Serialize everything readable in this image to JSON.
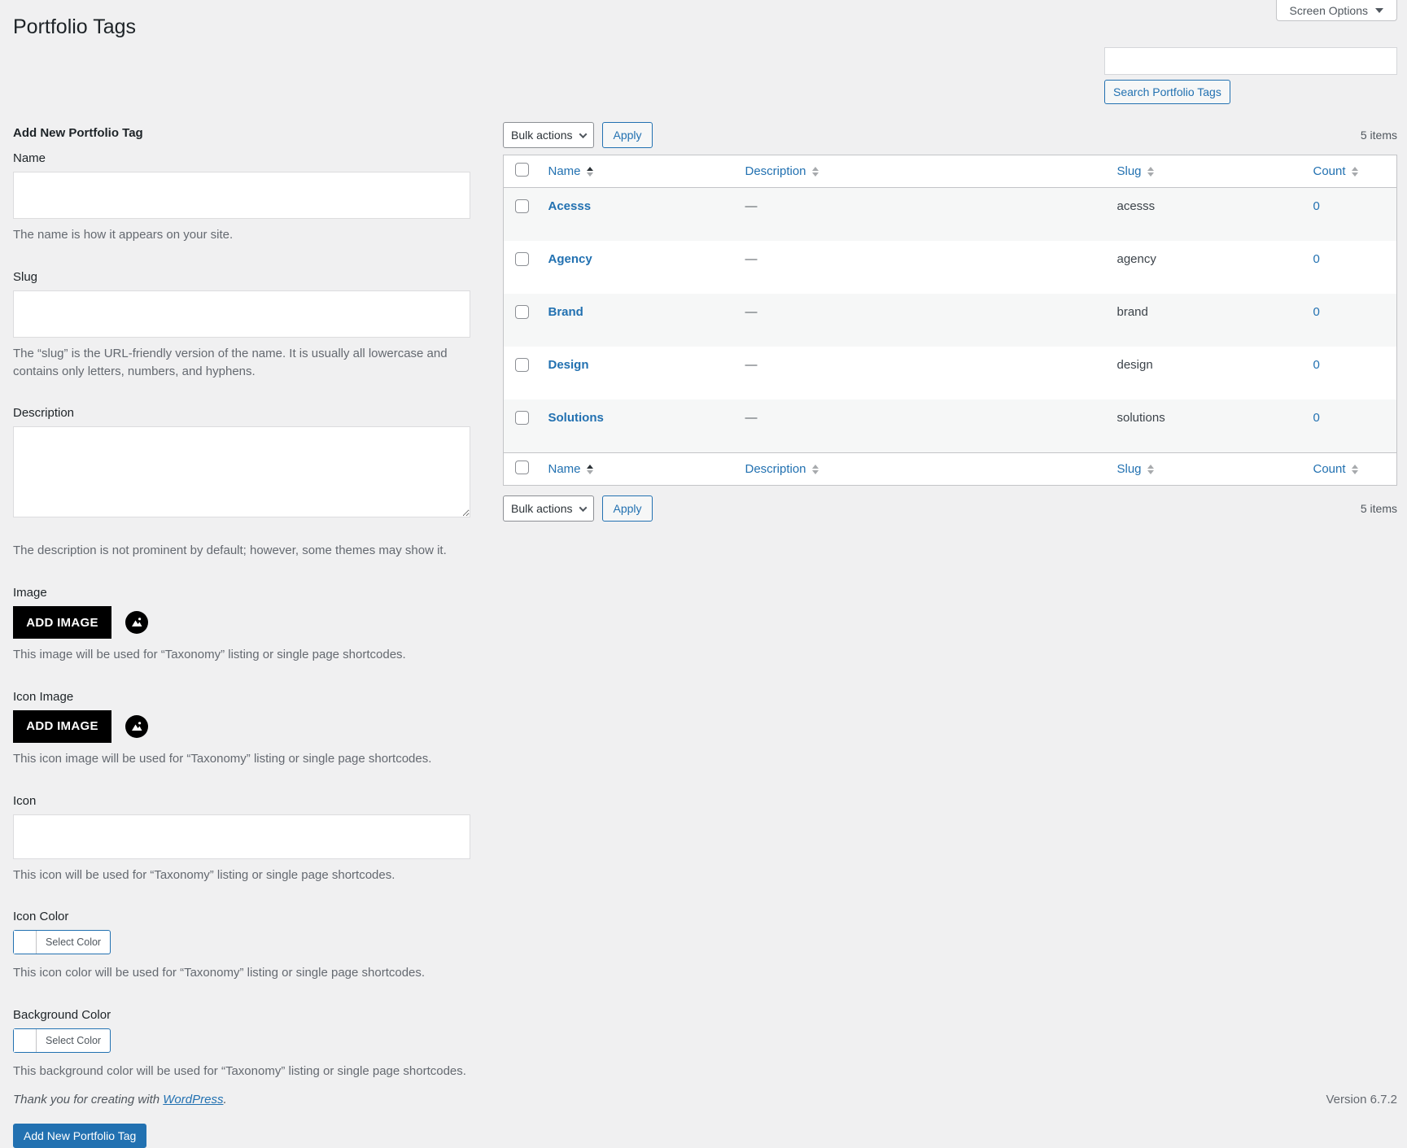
{
  "page": {
    "title": "Portfolio Tags",
    "screen_options_label": "Screen Options"
  },
  "search": {
    "input_value": "",
    "button_label": "Search Portfolio Tags"
  },
  "form": {
    "heading": "Add New Portfolio Tag",
    "name": {
      "label": "Name",
      "value": "",
      "help": "The name is how it appears on your site."
    },
    "slug": {
      "label": "Slug",
      "value": "",
      "help": "The “slug” is the URL-friendly version of the name. It is usually all lowercase and contains only letters, numbers, and hyphens."
    },
    "description": {
      "label": "Description",
      "value": "",
      "help": "The description is not prominent by default; however, some themes may show it."
    },
    "image": {
      "label": "Image",
      "button_label": "ADD IMAGE",
      "icon": "image-circle-icon",
      "help": "This image will be used for “Taxonomy” listing or single page shortcodes."
    },
    "icon_image": {
      "label": "Icon Image",
      "button_label": "ADD IMAGE",
      "icon": "image-circle-icon",
      "help": "This icon image will be used for “Taxonomy” listing or single page shortcodes."
    },
    "icon": {
      "label": "Icon",
      "value": "",
      "help": "This icon will be used for “Taxonomy” listing or single page shortcodes."
    },
    "icon_color": {
      "label": "Icon Color",
      "button_label": "Select Color",
      "help": "This icon color will be used for “Taxonomy” listing or single page shortcodes."
    },
    "background_color": {
      "label": "Background Color",
      "button_label": "Select Color",
      "help": "This background color will be used for “Taxonomy” listing or single page shortcodes."
    },
    "submit_label": "Add New Portfolio Tag"
  },
  "table": {
    "bulk_actions_label": "Bulk actions",
    "apply_label": "Apply",
    "items_count": "5 items",
    "columns": {
      "name": "Name",
      "description": "Description",
      "slug": "Slug",
      "count": "Count"
    },
    "sorted_by": "Name ascending",
    "rows": [
      {
        "name": "Acesss",
        "description": "—",
        "slug": "acesss",
        "count": "0"
      },
      {
        "name": "Agency",
        "description": "—",
        "slug": "agency",
        "count": "0"
      },
      {
        "name": "Brand",
        "description": "—",
        "slug": "brand",
        "count": "0"
      },
      {
        "name": "Design",
        "description": "—",
        "slug": "design",
        "count": "0"
      },
      {
        "name": "Solutions",
        "description": "—",
        "slug": "solutions",
        "count": "0"
      }
    ]
  },
  "footer": {
    "thanks_prefix": "Thank you for creating with ",
    "wordpress_link": "WordPress",
    "thanks_suffix": ".",
    "version": "Version 6.7.2"
  },
  "colors": {
    "accent": "#2271b1",
    "page_background": "#f0f0f1",
    "text": "#1d2327",
    "muted_text": "#646970",
    "table_border": "#c3c4c7",
    "row_alternate": "#f6f7f7",
    "add_image_button": "#000000"
  }
}
